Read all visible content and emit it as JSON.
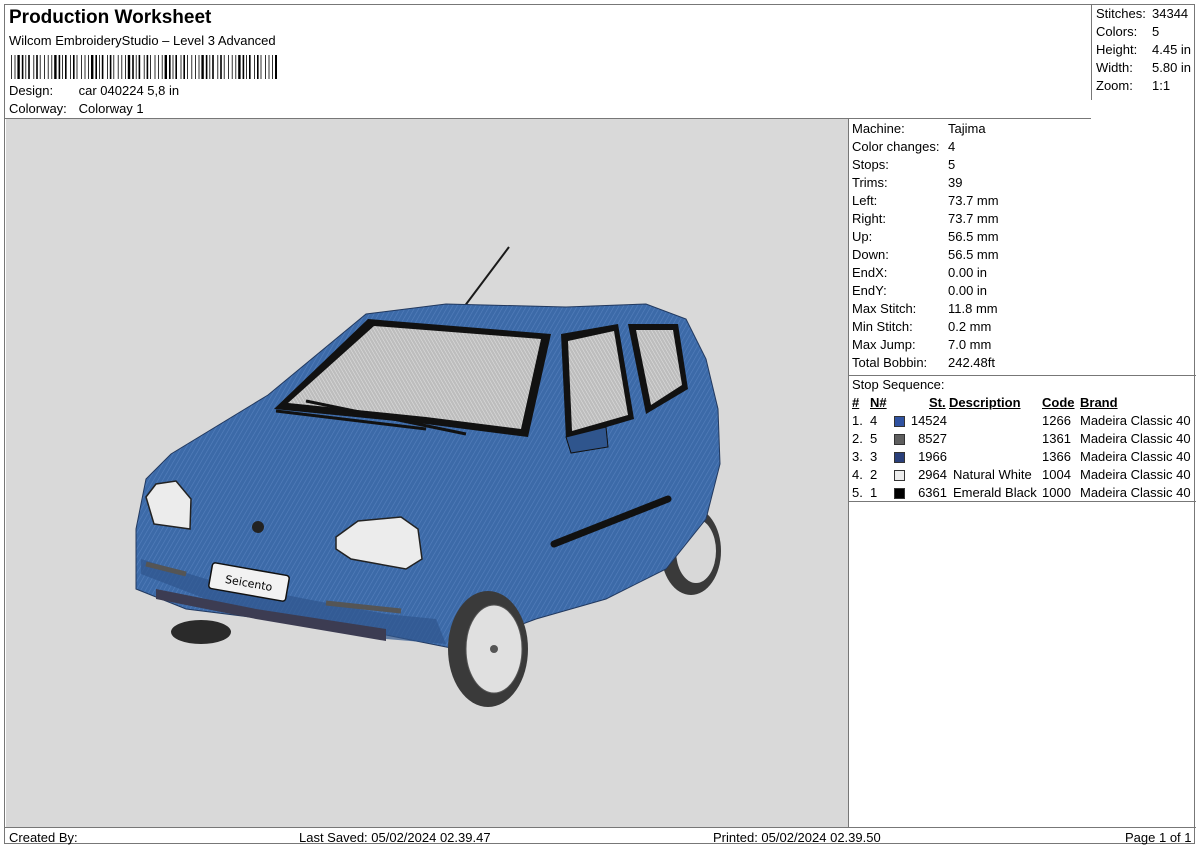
{
  "header": {
    "title": "Production Worksheet",
    "software": "Wilcom EmbroideryStudio – Level 3 Advanced",
    "design_label": "Design:",
    "design_value": "car 040224 5,8 in",
    "colorway_label": "Colorway:",
    "colorway_value": "Colorway 1"
  },
  "stats": [
    {
      "label": "Stitches:",
      "value": "34344"
    },
    {
      "label": "Colors:",
      "value": "5"
    },
    {
      "label": "Height:",
      "value": "4.45 in"
    },
    {
      "label": "Width:",
      "value": "5.80 in"
    },
    {
      "label": "Zoom:",
      "value": "1:1"
    }
  ],
  "machine": [
    {
      "label": "Machine:",
      "value": "Tajima"
    },
    {
      "label": "Color changes:",
      "value": "4"
    },
    {
      "label": "Stops:",
      "value": "5"
    },
    {
      "label": "Trims:",
      "value": "39"
    },
    {
      "label": "Left:",
      "value": "73.7 mm"
    },
    {
      "label": "Right:",
      "value": "73.7 mm"
    },
    {
      "label": "Up:",
      "value": "56.5 mm"
    },
    {
      "label": "Down:",
      "value": "56.5 mm"
    },
    {
      "label": "EndX:",
      "value": "0.00 in"
    },
    {
      "label": "EndY:",
      "value": "0.00 in"
    },
    {
      "label": "Max Stitch:",
      "value": "11.8 mm"
    },
    {
      "label": "Min Stitch:",
      "value": "0.2 mm"
    },
    {
      "label": "Max Jump:",
      "value": "7.0 mm"
    },
    {
      "label": "Total Bobbin:",
      "value": "242.48ft"
    }
  ],
  "stop_sequence": {
    "title": "Stop Sequence:",
    "headers": {
      "num": "#",
      "n": "N#",
      "st": "St.",
      "desc": "Description",
      "code": "Code",
      "brand": "Brand"
    },
    "rows": [
      {
        "num": "1.",
        "n": "4",
        "color": "#2f52a0",
        "st": "14524",
        "desc": "",
        "code": "1266",
        "brand": "Madeira Classic 40"
      },
      {
        "num": "2.",
        "n": "5",
        "color": "#5e5e5e",
        "st": "8527",
        "desc": "",
        "code": "1361",
        "brand": "Madeira Classic 40"
      },
      {
        "num": "3.",
        "n": "3",
        "color": "#2a3f7a",
        "st": "1966",
        "desc": "",
        "code": "1366",
        "brand": "Madeira Classic 40"
      },
      {
        "num": "4.",
        "n": "2",
        "color": "#ececec",
        "st": "2964",
        "desc": "Natural White",
        "code": "1004",
        "brand": "Madeira Classic 40"
      },
      {
        "num": "5.",
        "n": "1",
        "color": "#000000",
        "st": "6361",
        "desc": "Emerald Black",
        "code": "1000",
        "brand": "Madeira Classic 40"
      }
    ]
  },
  "preview": {
    "plate_text": "Seicento",
    "body_color": "#3c6aa8",
    "background": "#d9d9d9"
  },
  "footer": {
    "created_by": "Created By:",
    "last_saved": "Last Saved: 05/02/2024 02.39.47",
    "printed": "Printed: 05/02/2024 02.39.50",
    "page": "Page 1 of 1"
  }
}
